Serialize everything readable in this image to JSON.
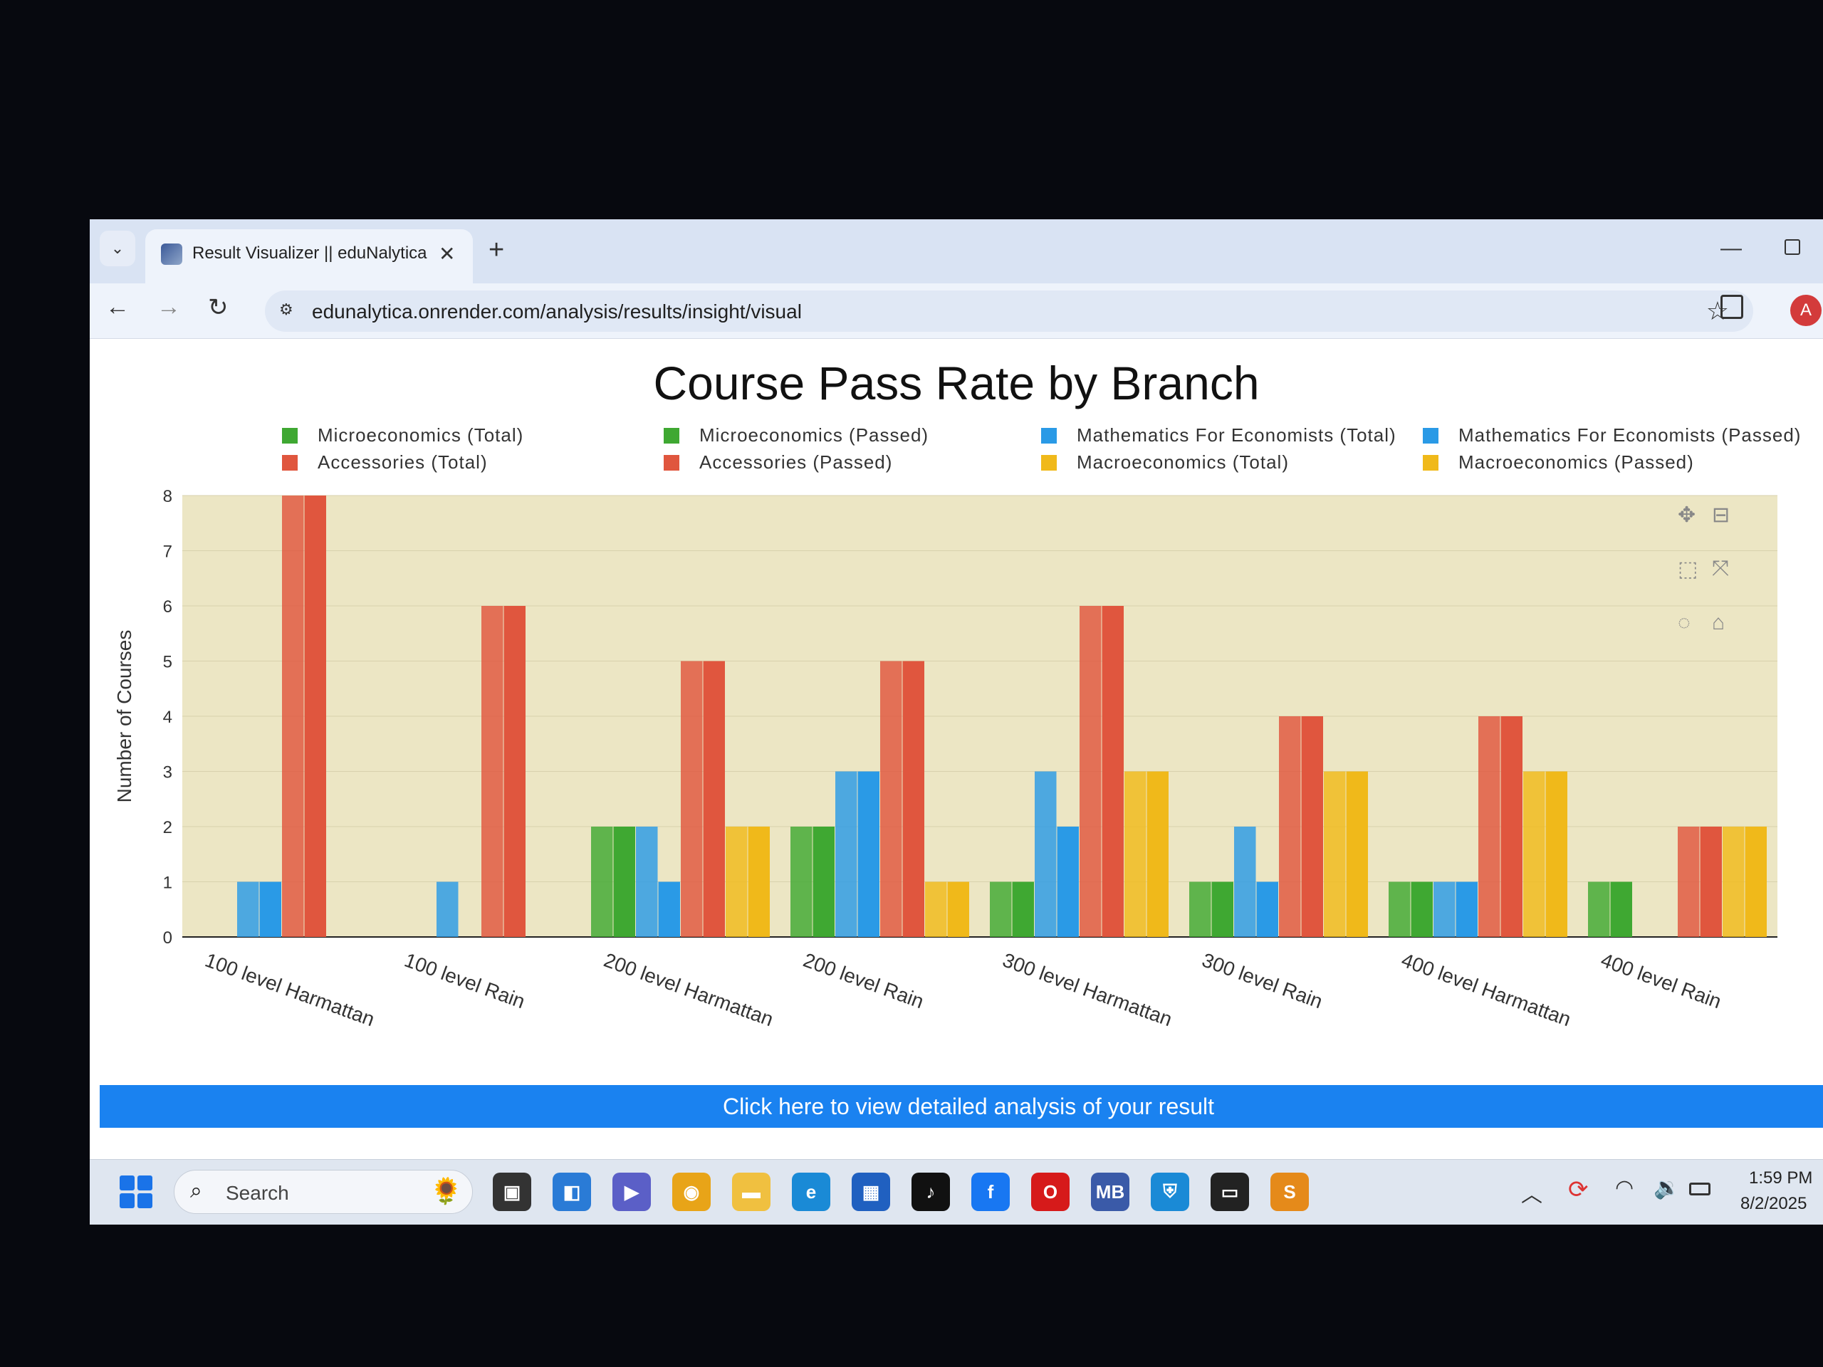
{
  "browser": {
    "tab_title": "Result Visualizer || eduNalytica",
    "tab_close": "✕",
    "new_tab": "+",
    "url": "edunalytica.onrender.com/analysis/results/insight/visual",
    "profile_initial": "A"
  },
  "page": {
    "cta_label": "Click here to view detailed analysis of your result"
  },
  "colors": {
    "micro": "#3fa832",
    "accessories": "#e0563e",
    "math": "#2a9ae6",
    "macro": "#f0b91a",
    "plot_bg": "#ece6c4",
    "cta": "#1a82f0"
  },
  "chart_data": {
    "type": "bar",
    "title": "Course Pass Rate by Branch",
    "ylabel": "Number of Courses",
    "xlabel": "",
    "ylim": [
      0,
      8
    ],
    "yticks": [
      "0",
      "1",
      "2",
      "3",
      "4",
      "5",
      "6",
      "7",
      "8"
    ],
    "categories": [
      "100 level Harmattan",
      "100 level Rain",
      "200 level Harmattan",
      "200 level Rain",
      "300 level Harmattan",
      "300 level Rain",
      "400 level Harmattan",
      "400 level Rain"
    ],
    "series": [
      {
        "name": "Microeconomics (Total)",
        "color": "#3fa832",
        "values": [
          0,
          0,
          2,
          2,
          1,
          1,
          1,
          1
        ]
      },
      {
        "name": "Microeconomics (Passed)",
        "color": "#3fa832",
        "values": [
          0,
          0,
          2,
          2,
          1,
          1,
          1,
          1
        ]
      },
      {
        "name": "Mathematics For Economists (Total)",
        "color": "#2a9ae6",
        "values": [
          1,
          1,
          2,
          3,
          3,
          2,
          1,
          0
        ]
      },
      {
        "name": "Mathematics For Economists (Passed)",
        "color": "#2a9ae6",
        "values": [
          1,
          0,
          1,
          3,
          2,
          1,
          1,
          0
        ]
      },
      {
        "name": "Accessories (Total)",
        "color": "#e0563e",
        "values": [
          8,
          6,
          5,
          5,
          6,
          4,
          4,
          2
        ]
      },
      {
        "name": "Accessories (Passed)",
        "color": "#e0563e",
        "values": [
          8,
          6,
          5,
          5,
          6,
          4,
          4,
          2
        ]
      },
      {
        "name": "Macroeconomics (Total)",
        "color": "#f0b91a",
        "values": [
          0,
          0,
          2,
          1,
          3,
          3,
          3,
          2
        ]
      },
      {
        "name": "Macroeconomics (Passed)",
        "color": "#f0b91a",
        "values": [
          0,
          0,
          2,
          1,
          3,
          3,
          3,
          2
        ]
      }
    ],
    "legend_placement": "top",
    "grid": true
  },
  "taskbar": {
    "search_label": "Search",
    "time": "1:59 PM",
    "date": "8/2/2025",
    "apps": [
      "task-view-icon",
      "widgets-icon",
      "teams-icon",
      "chrome-icon",
      "file-explorer-icon",
      "edge-icon",
      "store-icon",
      "tiktok-icon",
      "facebook-icon",
      "opera-icon",
      "mb-icon",
      "defender-icon",
      "terminal-icon",
      "sublime-icon"
    ]
  }
}
